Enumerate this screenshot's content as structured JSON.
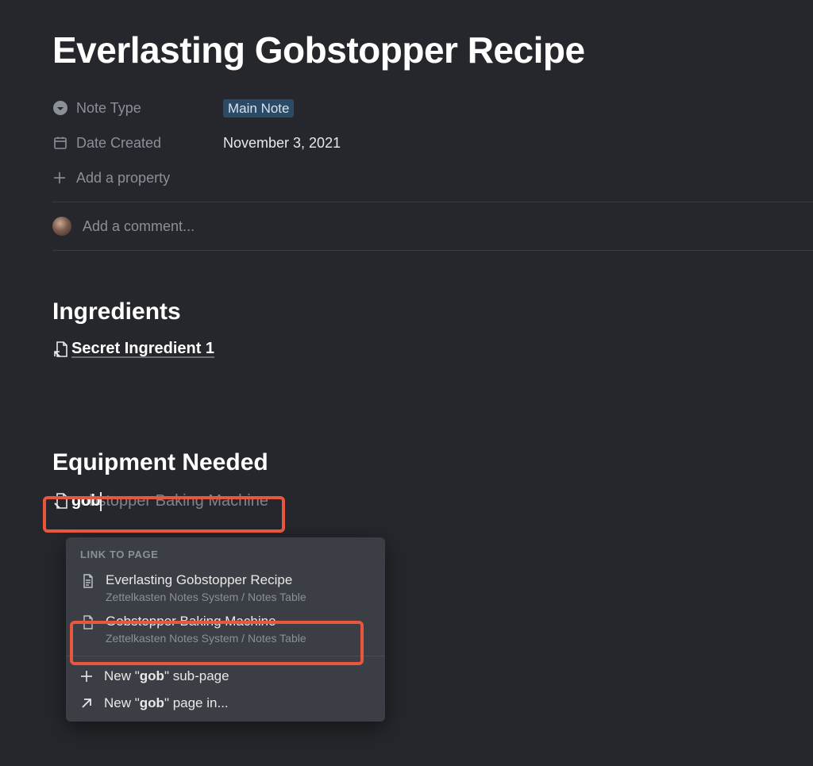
{
  "title": "Everlasting Gobstopper Recipe",
  "properties": {
    "noteType": {
      "label": "Note Type",
      "value": "Main Note"
    },
    "dateCreated": {
      "label": "Date Created",
      "value": "November 3, 2021"
    },
    "addPropertyLabel": "Add a property"
  },
  "comment": {
    "placeholder": "Add a comment..."
  },
  "sections": {
    "ingredients": {
      "heading": "Ingredients",
      "link": "Secret Ingredient 1"
    },
    "equipment": {
      "heading": "Equipment Needed",
      "typed": "gob",
      "ghost": "gobstopper Baking Machine"
    }
  },
  "menu": {
    "header": "LINK TO PAGE",
    "items": [
      {
        "title": "Everlasting Gobstopper Recipe",
        "path": "Zettelkasten Notes System / Notes Table"
      },
      {
        "title": "Gobstopper Baking Machine",
        "path": "Zettelkasten Notes System / Notes Table"
      }
    ],
    "actions": {
      "newSubPrefix": "New \"",
      "newSubTerm": "gob",
      "newSubSuffix": "\" sub-page",
      "newInPrefix": "New \"",
      "newInTerm": "gob",
      "newInSuffix": "\" page in..."
    }
  }
}
